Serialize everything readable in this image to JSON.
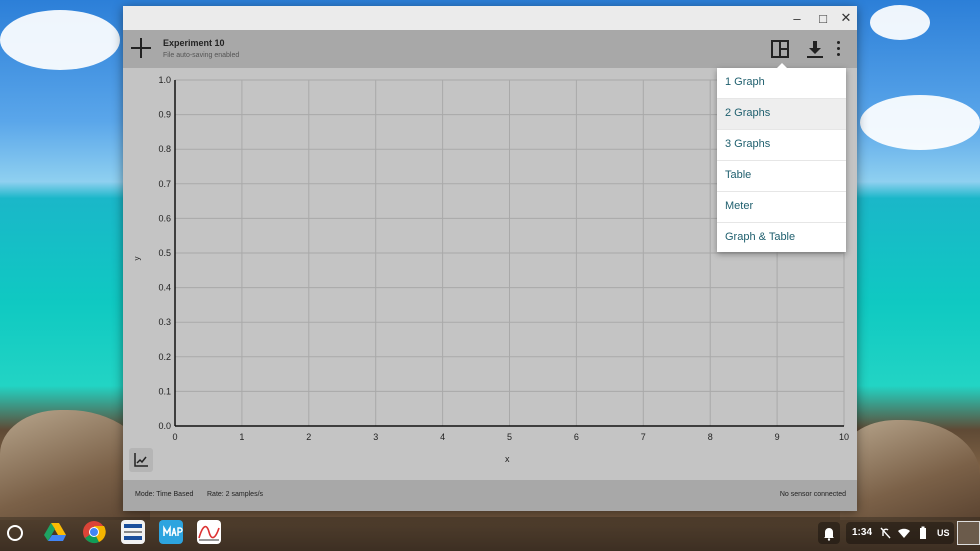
{
  "window": {
    "minimize_glyph": "–",
    "maximize_glyph": "□",
    "close_glyph": "✕"
  },
  "toolbar": {
    "experiment_title": "Experiment 10",
    "autosave_status": "File auto-saving enabled"
  },
  "chart_data": {
    "type": "line",
    "title": "",
    "xlabel": "x",
    "ylabel": "y",
    "xlim": [
      0,
      10
    ],
    "ylim": [
      0.0,
      1.0
    ],
    "x_ticks": [
      "0",
      "1",
      "2",
      "3",
      "4",
      "5",
      "6",
      "7",
      "8",
      "9",
      "10"
    ],
    "y_ticks": [
      "0.0",
      "0.1",
      "0.2",
      "0.3",
      "0.4",
      "0.5",
      "0.6",
      "0.7",
      "0.8",
      "0.9",
      "1.0"
    ],
    "grid": true,
    "series": []
  },
  "layout_menu": {
    "items": [
      {
        "label": "1 Graph",
        "active": false
      },
      {
        "label": "2 Graphs",
        "active": true
      },
      {
        "label": "3 Graphs",
        "active": false
      },
      {
        "label": "Table",
        "active": false
      },
      {
        "label": "Meter",
        "active": false
      },
      {
        "label": "Graph & Table",
        "active": false
      }
    ]
  },
  "statusbar": {
    "mode": "Mode: Time Based",
    "rate": "Rate: 2 samples/s",
    "sensor": "No sensor connected"
  },
  "shelf": {
    "clock": "1:34",
    "language": "US",
    "apps": [
      "google-drive-icon",
      "chrome-icon",
      "pearson-testnav-icon",
      "map-icon",
      "graphing-app-icon"
    ]
  },
  "colors": {
    "menu_text": "#1f5f6e",
    "chart_background": "#c4c4c4",
    "toolbar_background": "#a8a8a8"
  }
}
